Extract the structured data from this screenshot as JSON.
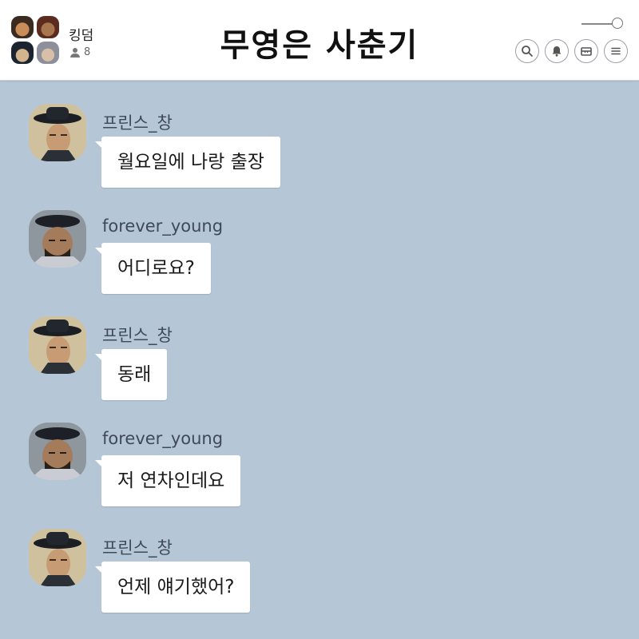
{
  "header": {
    "room_name": "킹덤",
    "member_count": "8",
    "title": "무영은 사춘기",
    "icons": [
      "search-icon",
      "bell-icon",
      "inbox-icon",
      "menu-icon"
    ]
  },
  "senders": {
    "prince": "프린스_창",
    "forever": "forever_young"
  },
  "messages": [
    {
      "sender": "프린스_창",
      "text": "월요일에 나랑 출장"
    },
    {
      "sender": "forever_young",
      "text": "어디로요?"
    },
    {
      "sender": "프린스_창",
      "text": "동래"
    },
    {
      "sender": "forever_young",
      "text": "저 연차인데요"
    },
    {
      "sender": "프린스_창",
      "text": "언제 얘기했어?"
    }
  ],
  "colors": {
    "chat_background": "#b5c6d7",
    "bubble": "#ffffff",
    "header": "#ffffff"
  }
}
